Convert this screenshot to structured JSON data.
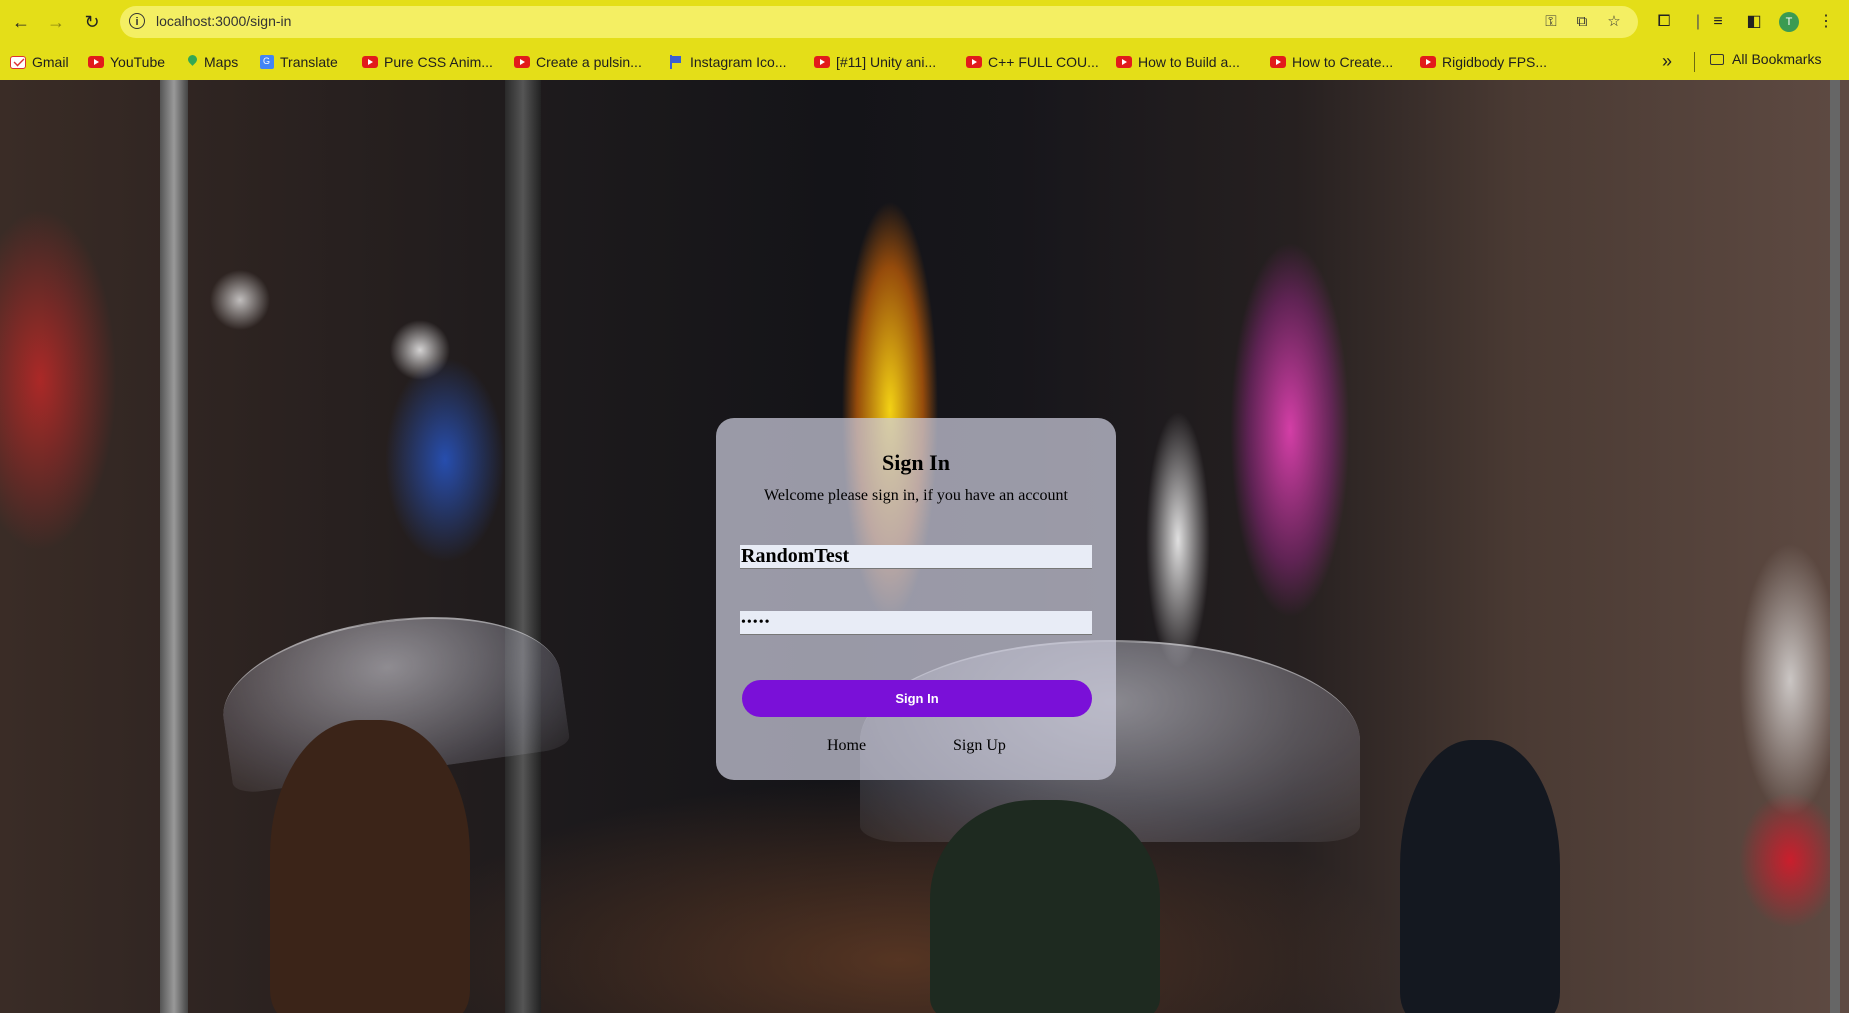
{
  "browser": {
    "url": "localhost:3000/sign-in",
    "avatar_letter": "T",
    "bookmarks": [
      {
        "label": "Gmail",
        "icon": "gmail-icon"
      },
      {
        "label": "YouTube",
        "icon": "youtube-icon"
      },
      {
        "label": "Maps",
        "icon": "maps-icon"
      },
      {
        "label": "Translate",
        "icon": "translate-icon"
      },
      {
        "label": "Pure CSS Anim...",
        "icon": "youtube-icon"
      },
      {
        "label": "Create a pulsin...",
        "icon": "youtube-icon"
      },
      {
        "label": "Instagram Ico...",
        "icon": "flag-icon"
      },
      {
        "label": "[#11] Unity ani...",
        "icon": "youtube-icon"
      },
      {
        "label": "C++ FULL COU...",
        "icon": "youtube-icon"
      },
      {
        "label": "How to Build a...",
        "icon": "youtube-icon"
      },
      {
        "label": "How to Create...",
        "icon": "youtube-icon"
      },
      {
        "label": "Rigidbody FPS...",
        "icon": "youtube-icon"
      }
    ],
    "all_bookmarks": "All Bookmarks",
    "toolbar_color": "#e4de18"
  },
  "signin": {
    "title": "Sign In",
    "subtitle": "Welcome please sign in, if you have an account",
    "username_value": "RandomTest",
    "password_value": "•••••",
    "submit_label": "Sign In",
    "home_link": "Home",
    "signup_link": "Sign Up",
    "button_color": "#7a10d8"
  }
}
